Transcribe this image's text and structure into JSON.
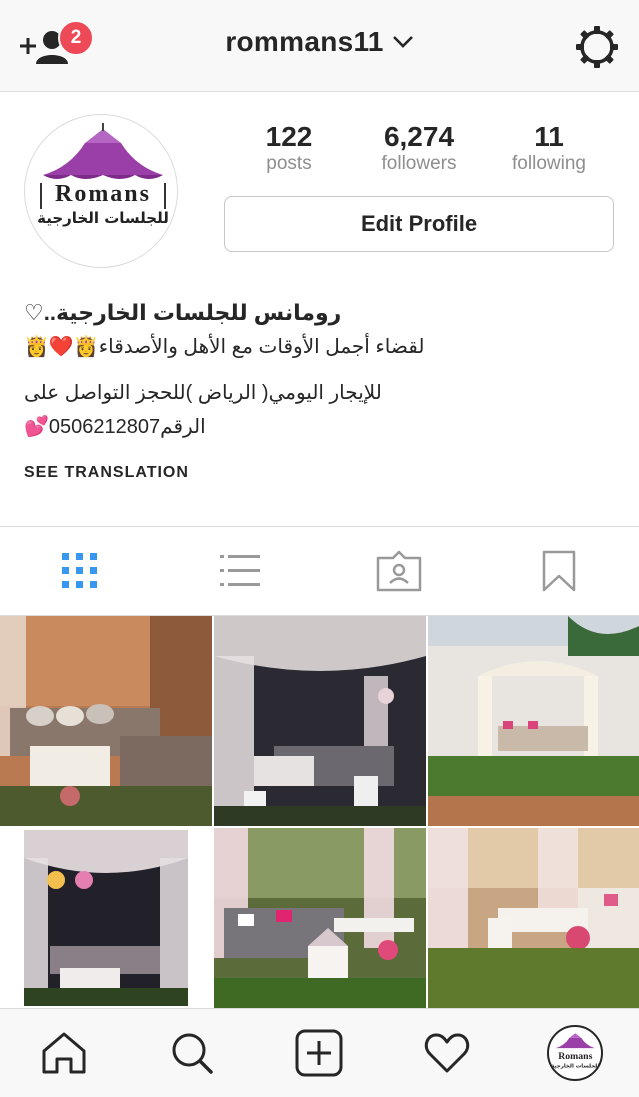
{
  "header": {
    "username": "rommans11",
    "notification_count": "2"
  },
  "profile": {
    "logo_text": "Romans",
    "logo_subtext": "للجلسات الخارجية",
    "stats": [
      {
        "value": "122",
        "label": "posts"
      },
      {
        "value": "6,274",
        "label": "followers"
      },
      {
        "value": "11",
        "label": "following"
      }
    ],
    "edit_label": "Edit Profile"
  },
  "bio": {
    "name": "رومانس للجلسات الخارجية..♡",
    "line1": "لقضاء أجمل الأوقات مع الأهل والأصدقاء👸❤️👸",
    "line2": "للإيجار اليومي( الرياض )للحجز التواصل على",
    "line3": "الرقم0506212807💕",
    "see_translation": "SEE TRANSLATION"
  },
  "tabs": [
    {
      "icon": "grid-icon",
      "active": true
    },
    {
      "icon": "list-icon",
      "active": false
    },
    {
      "icon": "tagged-icon",
      "active": false
    },
    {
      "icon": "bookmark-icon",
      "active": false
    }
  ],
  "colors": {
    "accent_blue": "#3897f0",
    "badge_red": "#ed4956",
    "logo_purple": "#9b3fa8"
  },
  "bottom_nav": [
    "home-icon",
    "search-icon",
    "new-post-icon",
    "activity-heart-icon",
    "profile-avatar"
  ]
}
